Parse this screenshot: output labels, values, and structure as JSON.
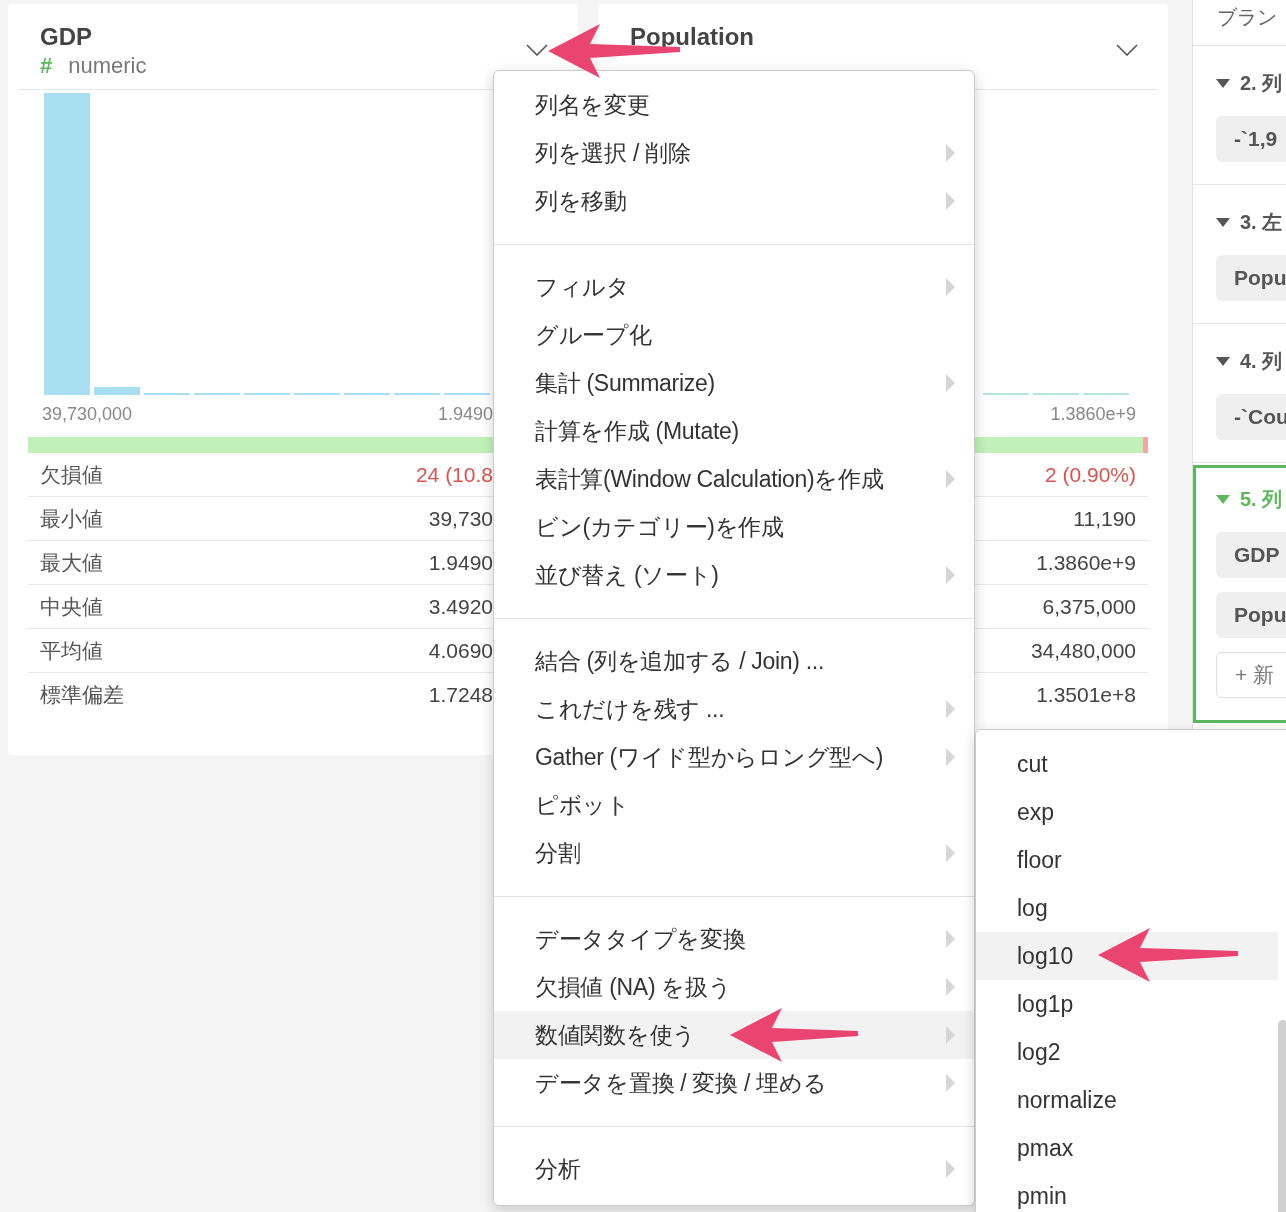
{
  "cards": [
    {
      "title": "GDP",
      "type_icon": "#",
      "type": "numeric",
      "axis_min": "39,730,000",
      "axis_max": "1.9490",
      "level": 0.892,
      "stats": [
        {
          "label": "欠損値",
          "value": "24 (10.8",
          "kind": "missing"
        },
        {
          "label": "最小値",
          "value": "39,730",
          "kind": "plain"
        },
        {
          "label": "最大値",
          "value": "1.9490",
          "kind": "plain"
        },
        {
          "label": "中央値",
          "value": "3.4920",
          "kind": "plain"
        },
        {
          "label": "平均値",
          "value": "4.0690",
          "kind": "plain"
        },
        {
          "label": "標準偏差",
          "value": "1.7248",
          "kind": "plain"
        }
      ]
    },
    {
      "title": "Population",
      "axis_max": "1.3860e+9",
      "level": 0.991,
      "stats": [
        {
          "value": "2 (0.90%)",
          "kind": "missing"
        },
        {
          "value": "11,190",
          "kind": "plain"
        },
        {
          "value": "1.3860e+9",
          "kind": "plain"
        },
        {
          "value": "6,375,000",
          "kind": "plain"
        },
        {
          "value": "34,480,000",
          "kind": "plain"
        },
        {
          "value": "1.3501e+8",
          "kind": "plain"
        }
      ]
    }
  ],
  "steps_panel": {
    "heading": "ブラン",
    "steps": [
      {
        "title": "2. 列",
        "selected": false,
        "chips": [
          {
            "kind": "value",
            "label": "-`1,9"
          }
        ]
      },
      {
        "title": "3. 左",
        "selected": false,
        "chips": [
          {
            "kind": "value",
            "label": "Popu"
          }
        ]
      },
      {
        "title": "4. 列",
        "selected": false,
        "chips": [
          {
            "kind": "value",
            "label": "-`Cou"
          }
        ]
      },
      {
        "title": "5. 列",
        "selected": true,
        "chips": [
          {
            "kind": "value",
            "label": "GDP"
          },
          {
            "kind": "value",
            "label": "Popu"
          },
          {
            "kind": "add",
            "label": "+ 新"
          }
        ]
      }
    ]
  },
  "column_menu": {
    "groups": [
      [
        {
          "label": "列名を変更",
          "submenu": false,
          "selected": false
        },
        {
          "label": "列を選択 / 削除",
          "submenu": true,
          "selected": false
        },
        {
          "label": "列を移動",
          "submenu": true,
          "selected": false
        }
      ],
      [
        {
          "label": "フィルタ",
          "submenu": true,
          "selected": false
        },
        {
          "label": "グループ化",
          "submenu": false,
          "selected": false
        },
        {
          "label": "集計 (Summarize)",
          "submenu": true,
          "selected": false
        },
        {
          "label": "計算を作成 (Mutate)",
          "submenu": false,
          "selected": false
        },
        {
          "label": "表計算(Window Calculation)を作成",
          "submenu": true,
          "selected": false
        },
        {
          "label": "ビン(カテゴリー)を作成",
          "submenu": false,
          "selected": false
        },
        {
          "label": "並び替え (ソート)",
          "submenu": true,
          "selected": false
        }
      ],
      [
        {
          "label": "結合 (列を追加する / Join) ...",
          "submenu": false,
          "selected": false
        },
        {
          "label": "これだけを残す ...",
          "submenu": true,
          "selected": false
        },
        {
          "label": "Gather (ワイド型からロング型へ)",
          "submenu": true,
          "selected": false
        },
        {
          "label": "ピボット",
          "submenu": false,
          "selected": false
        },
        {
          "label": "分割",
          "submenu": true,
          "selected": false
        }
      ],
      [
        {
          "label": "データタイプを変換",
          "submenu": true,
          "selected": false
        },
        {
          "label": "欠損値 (NA) を扱う",
          "submenu": true,
          "selected": false
        },
        {
          "label": "数値関数を使う",
          "submenu": true,
          "selected": true
        },
        {
          "label": "データを置換 / 変換 / 埋める",
          "submenu": true,
          "selected": false
        }
      ],
      [
        {
          "label": "分析",
          "submenu": true,
          "selected": false
        }
      ]
    ]
  },
  "function_submenu": {
    "items": [
      {
        "label": "cut",
        "selected": false
      },
      {
        "label": "exp",
        "selected": false
      },
      {
        "label": "floor",
        "selected": false
      },
      {
        "label": "log",
        "selected": false
      },
      {
        "label": "log10",
        "selected": true
      },
      {
        "label": "log1p",
        "selected": false
      },
      {
        "label": "log2",
        "selected": false
      },
      {
        "label": "normalize",
        "selected": false
      },
      {
        "label": "pmax",
        "selected": false
      },
      {
        "label": "pmin",
        "selected": false
      }
    ]
  }
}
